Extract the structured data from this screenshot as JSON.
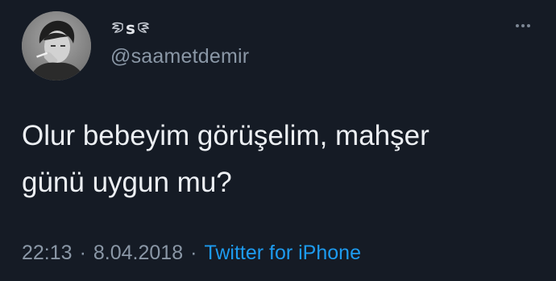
{
  "tweet": {
    "author": {
      "display_name_letter": "s",
      "handle": "@saametdemir",
      "avatar_icon": "profile-photo-icon",
      "name_decoration_icon": "angel-wings-icon"
    },
    "text_lines": [
      "Olur bebeyim görüşelim, mahşer",
      "günü uygun mu?"
    ],
    "timestamp_time": "22:13",
    "timestamp_date": "8.04.2018",
    "separator": "·",
    "source": "Twitter for iPhone",
    "more_icon": "more-options-icon"
  },
  "colors": {
    "background": "#151b25",
    "text": "#eceff3",
    "secondary_text": "#8a97a6",
    "link": "#1d9bf0"
  }
}
